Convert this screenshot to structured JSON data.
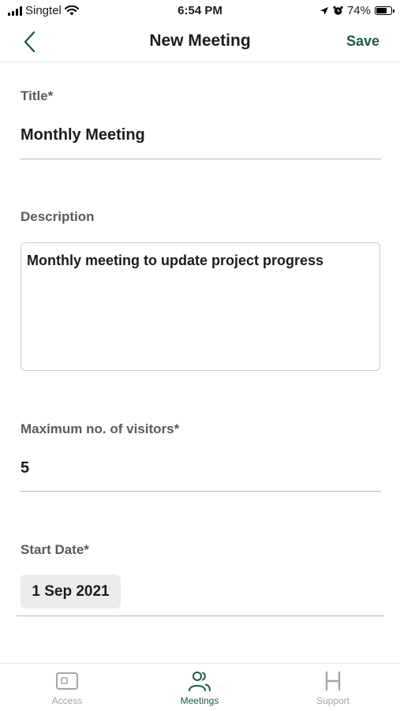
{
  "status_bar": {
    "carrier": "Singtel",
    "time": "6:54 PM",
    "battery": "74%",
    "battery_level": 0.74
  },
  "nav": {
    "title": "New Meeting",
    "save_label": "Save"
  },
  "form": {
    "title_label": "Title*",
    "title_value": "Monthly Meeting",
    "description_label": "Description",
    "description_value": "Monthly meeting to update project progress",
    "max_visitors_label": "Maximum no. of visitors*",
    "max_visitors_value": "5",
    "start_date_label": "Start Date*",
    "start_date_value": "1 Sep 2021"
  },
  "tabs": [
    {
      "label": "Access",
      "icon": "access-card-icon",
      "active": false
    },
    {
      "label": "Meetings",
      "icon": "people-icon",
      "active": true
    },
    {
      "label": "Support",
      "icon": "h-support-icon",
      "active": false
    }
  ],
  "colors": {
    "accent": "#1f5c3e",
    "inactive": "#a5a5aa"
  }
}
